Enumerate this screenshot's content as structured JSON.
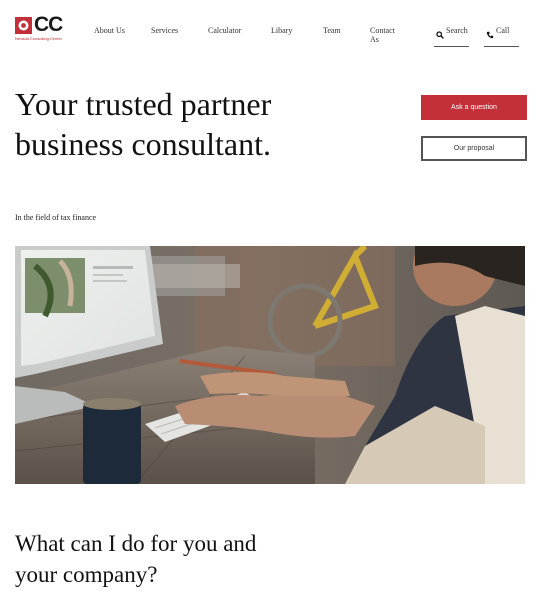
{
  "header": {
    "logo": {
      "brand": "CC",
      "subtitle": "Nevada Consulting Center"
    },
    "nav": [
      {
        "label": "About Us"
      },
      {
        "label": "Services"
      },
      {
        "label": "Calculator"
      },
      {
        "label": "Libary"
      },
      {
        "label": "Team"
      },
      {
        "label": "Contact As"
      }
    ],
    "search_label": "Search",
    "call_label": "Call"
  },
  "hero": {
    "title": "Your trusted partner business consultant.",
    "ask_button": "Ask a question",
    "proposal_button": "Our proposal",
    "tagline": "In the field of tax finance"
  },
  "section": {
    "title": "What can I do for you and your company?"
  },
  "colors": {
    "accent": "#c3303a",
    "text": "#111111"
  }
}
